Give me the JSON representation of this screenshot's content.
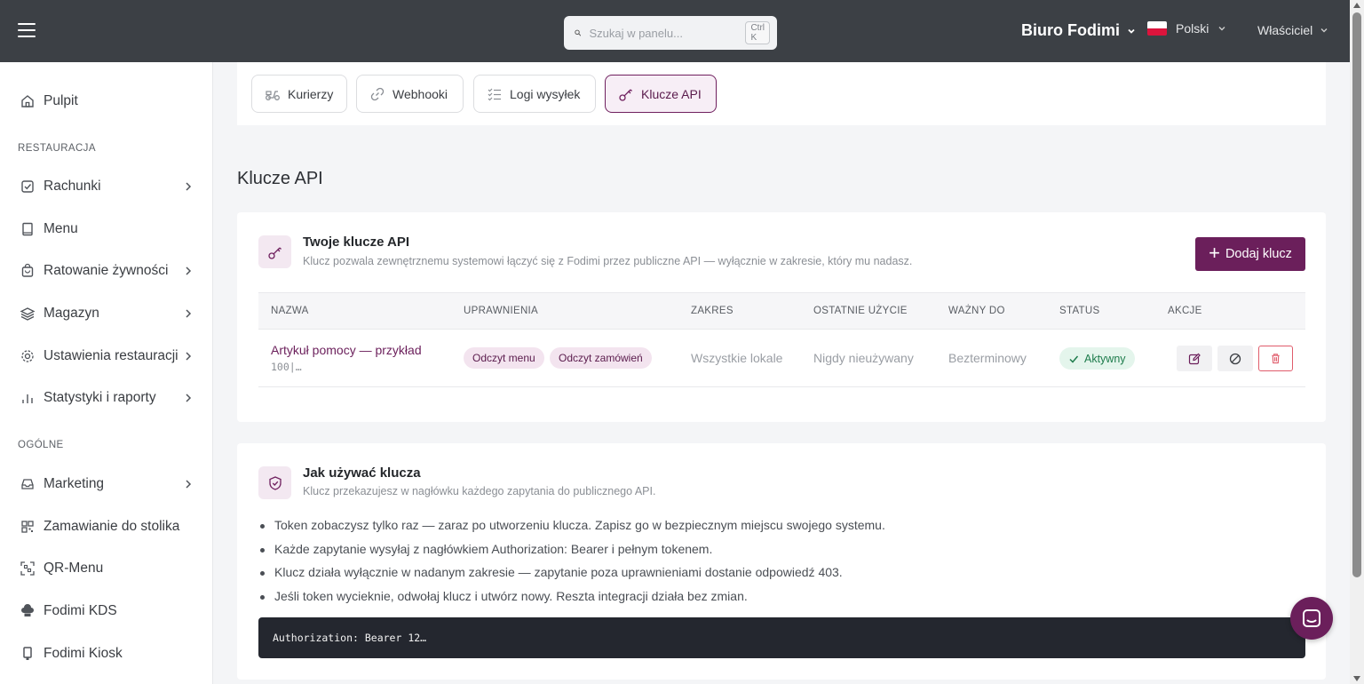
{
  "topbar": {
    "search_placeholder": "Szukaj w panelu...",
    "search_shortcut": "Ctrl K",
    "org_name": "Biuro Fodimi",
    "language": "Polski",
    "role": "Właściciel"
  },
  "sidebar": {
    "dashboard": "Pulpit",
    "section_restaurant": "RESTAURACJA",
    "items_restaurant": [
      {
        "label": "Rachunki",
        "icon": "receipt-check-icon",
        "has_submenu": true
      },
      {
        "label": "Menu",
        "icon": "book-icon",
        "has_submenu": false
      },
      {
        "label": "Ratowanie żywności",
        "icon": "shopping-bag-icon",
        "has_submenu": true
      },
      {
        "label": "Magazyn",
        "icon": "layers-icon",
        "has_submenu": true
      },
      {
        "label": "Ustawienia restauracji",
        "icon": "gear-icon",
        "has_submenu": true
      },
      {
        "label": "Statystyki i raporty",
        "icon": "bar-chart-icon",
        "has_submenu": true
      }
    ],
    "section_general": "OGÓLNE",
    "items_general": [
      {
        "label": "Marketing",
        "icon": "inbox-icon",
        "has_submenu": true
      },
      {
        "label": "Zamawianie do stolika",
        "icon": "qr-grid-icon",
        "has_submenu": false
      },
      {
        "label": "QR-Menu",
        "icon": "qr-scan-icon",
        "has_submenu": false
      },
      {
        "label": "Fodimi KDS",
        "icon": "chef-hat-icon",
        "has_submenu": false
      },
      {
        "label": "Fodimi Kiosk",
        "icon": "kiosk-icon",
        "has_submenu": false
      }
    ]
  },
  "tabs": [
    {
      "label": "Kurierzy",
      "icon": "scooter-icon",
      "active": false
    },
    {
      "label": "Webhooki",
      "icon": "link-icon",
      "active": false
    },
    {
      "label": "Logi wysyłek",
      "icon": "list-check-icon",
      "active": false
    },
    {
      "label": "Klucze API",
      "icon": "key-icon",
      "active": true
    }
  ],
  "page_title": "Klucze API",
  "keys_card": {
    "title": "Twoje klucze API",
    "subtitle": "Klucz pozwala zewnętrznemu systemowi łączyć się z Fodimi przez publiczne API — wyłącznie w zakresie, który mu nadasz.",
    "add_button": "Dodaj klucz",
    "columns": [
      "NAZWA",
      "UPRAWNIENIA",
      "ZAKRES",
      "OSTATNIE UŻYCIE",
      "WAŻNY DO",
      "STATUS",
      "AKCJE"
    ],
    "rows": [
      {
        "name": "Artykuł pomocy — przykład",
        "prefix": "100|…",
        "permissions": [
          "Odczyt menu",
          "Odczyt zamówień"
        ],
        "scope": "Wszystkie lokale",
        "last_used": "Nigdy nieużywany",
        "valid_until": "Bezterminowy",
        "status": "Aktywny"
      }
    ]
  },
  "usage_card": {
    "title": "Jak używać klucza",
    "subtitle": "Klucz przekazujesz w nagłówku każdego zapytania do publicznego API.",
    "bullets": [
      "Token zobaczysz tylko raz — zaraz po utworzeniu klucza. Zapisz go w bezpiecznym miejscu swojego systemu.",
      "Każde zapytanie wysyłaj z nagłówkiem Authorization: Bearer i pełnym tokenem.",
      "Klucz działa wyłącznie w nadanym zakresie — zapytanie poza uprawnieniami dostanie odpowiedź 403.",
      "Jeśli token wycieknie, odwołaj klucz i utwórz nowy. Reszta integracji działa bez zmian."
    ],
    "code": "Authorization: Bearer 12…"
  },
  "colors": {
    "brand": "#6b1f5b",
    "topbar": "#3c4045",
    "status_active": "#1e7c4c",
    "danger": "#e05c6b"
  }
}
